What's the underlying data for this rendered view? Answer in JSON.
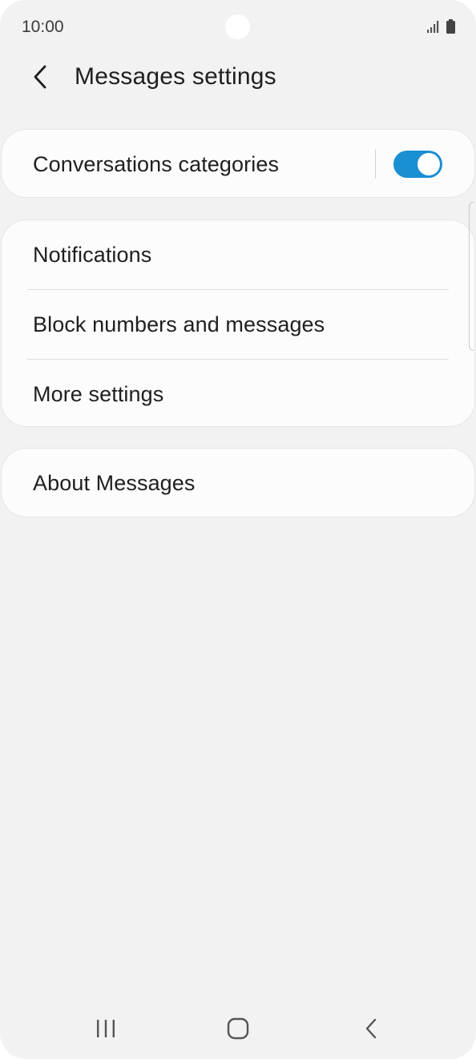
{
  "status_bar": {
    "time": "10:00"
  },
  "header": {
    "title": "Messages settings",
    "back_icon": "chevron-left-icon"
  },
  "settings": {
    "conversations_categories": {
      "label": "Conversations categories",
      "toggle_on": true
    },
    "group": [
      {
        "label": "Notifications"
      },
      {
        "label": "Block numbers and messages"
      },
      {
        "label": "More settings"
      }
    ],
    "about": {
      "label": "About Messages"
    }
  },
  "nav": {
    "recents_icon": "recents-icon",
    "home_icon": "home-icon",
    "back_icon": "back-icon"
  },
  "colors": {
    "accent": "#1a8fd2",
    "background": "#f2f2f2",
    "card": "#fcfcfc"
  }
}
